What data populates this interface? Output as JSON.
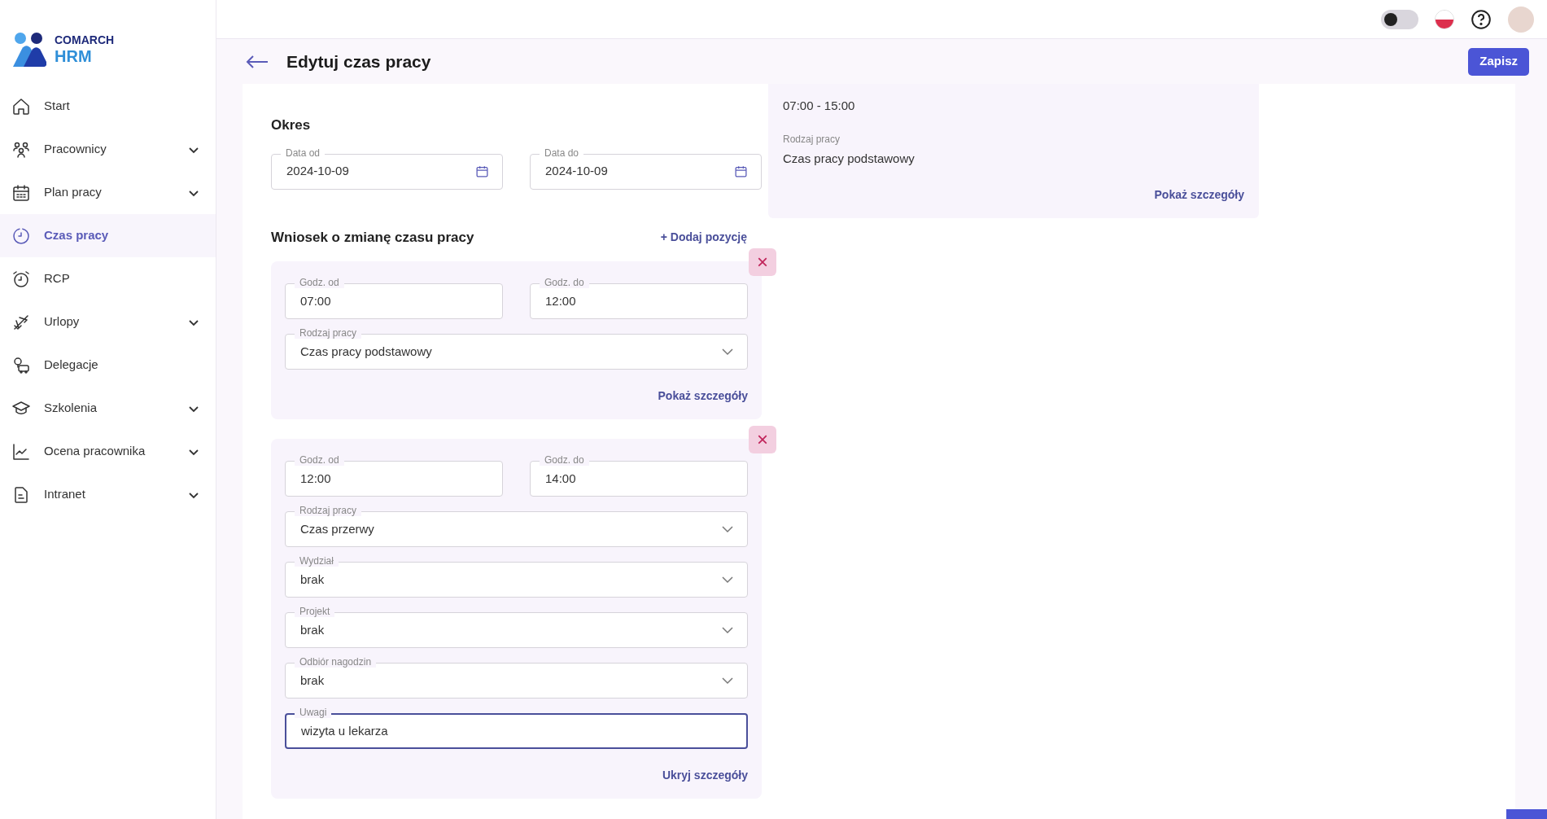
{
  "logo": {
    "line1": "COMARCH",
    "line2": "HRM"
  },
  "sidebar": {
    "items": [
      {
        "label": "Start",
        "expandable": false,
        "selected": false
      },
      {
        "label": "Pracownicy",
        "expandable": true,
        "selected": false
      },
      {
        "label": "Plan pracy",
        "expandable": true,
        "selected": false
      },
      {
        "label": "Czas pracy",
        "expandable": false,
        "selected": true
      },
      {
        "label": "RCP",
        "expandable": false,
        "selected": false
      },
      {
        "label": "Urlopy",
        "expandable": true,
        "selected": false
      },
      {
        "label": "Delegacje",
        "expandable": false,
        "selected": false
      },
      {
        "label": "Szkolenia",
        "expandable": true,
        "selected": false
      },
      {
        "label": "Ocena pracownika",
        "expandable": true,
        "selected": false
      },
      {
        "label": "Intranet",
        "expandable": true,
        "selected": false
      }
    ]
  },
  "topbar": {
    "dark_mode": false
  },
  "page": {
    "title": "Edytuj czas pracy",
    "save_button": "Zapisz"
  },
  "period": {
    "title": "Okres",
    "fields": [
      {
        "label": "Data od",
        "value": "2024-10-09"
      },
      {
        "label": "Data do",
        "value": "2024-10-09"
      }
    ]
  },
  "request": {
    "title": "Wniosek o zmianę czasu pracy",
    "add_link": "+ Dodaj pozycję",
    "entries": [
      {
        "close": "×",
        "link": "Pokaż szczegóły",
        "fields": [
          {
            "kind": "time",
            "label": "Godz. od",
            "value": "07:00",
            "focused": false
          },
          {
            "kind": "time",
            "label": "Godz. do",
            "value": "12:00",
            "focused": false
          },
          {
            "kind": "select",
            "label": "Rodzaj pracy",
            "value": "Czas pracy podstawowy",
            "focused": false
          }
        ]
      },
      {
        "close": "×",
        "link": "Ukryj szczegóły",
        "fields": [
          {
            "kind": "time",
            "label": "Godz. od",
            "value": "12:00",
            "focused": false
          },
          {
            "kind": "time",
            "label": "Godz. do",
            "value": "14:00",
            "focused": false
          },
          {
            "kind": "select",
            "label": "Rodzaj pracy",
            "value": "Czas przerwy",
            "focused": false
          },
          {
            "kind": "select",
            "label": "Wydział",
            "value": "brak",
            "focused": false
          },
          {
            "kind": "select",
            "label": "Projekt",
            "value": "brak",
            "focused": false
          },
          {
            "kind": "select",
            "label": "Odbiór nagodzin",
            "value": "brak",
            "focused": false
          },
          {
            "kind": "text",
            "label": "Uwagi",
            "value": "wizyta u lekarza",
            "focused": true
          }
        ]
      }
    ]
  },
  "summary": {
    "hours": "07:00 - 15:00",
    "work_type_label": "Rodzaj pracy",
    "work_type": "Czas pracy podstawowy",
    "link": "Pokaż szczegóły"
  }
}
